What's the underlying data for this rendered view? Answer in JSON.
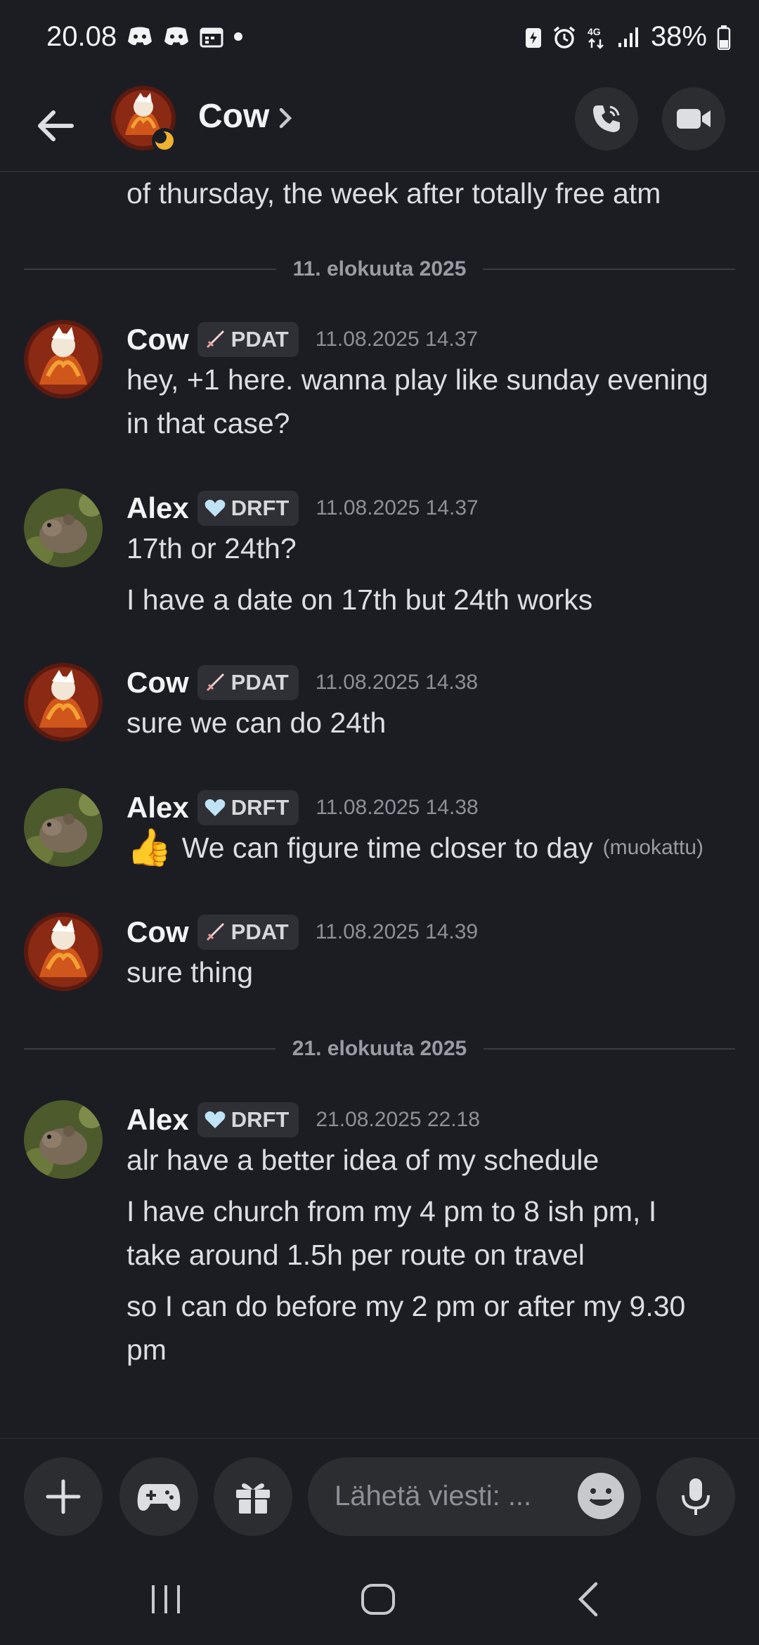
{
  "status_bar": {
    "time": "20.08",
    "battery": "38%",
    "network": "4G"
  },
  "header": {
    "title": "Cow",
    "back_icon": "arrow-left-icon",
    "call_icon": "phone-icon",
    "video_icon": "video-camera-icon"
  },
  "chat": {
    "top_partial": "of thursday, the week after totally free atm",
    "dividers": [
      "11. elokuuta 2025",
      "21. elokuuta 2025"
    ],
    "messages": [
      {
        "author": "Cow",
        "tag": "PDAT",
        "timestamp": "11.08.2025 14.37",
        "lines": [
          "hey, +1 here. wanna play like sunday evening",
          "in that case?"
        ]
      },
      {
        "author": "Alex",
        "tag": "DRFT",
        "timestamp": "11.08.2025 14.37",
        "lines": [
          "17th or 24th?",
          "I have a date on 17th but 24th works"
        ]
      },
      {
        "author": "Cow",
        "tag": "PDAT",
        "timestamp": "11.08.2025 14.38",
        "lines": [
          "sure we can do 24th"
        ]
      },
      {
        "author": "Alex",
        "tag": "DRFT",
        "timestamp": "11.08.2025 14.38",
        "lines": [
          "We can figure time closer to day"
        ],
        "emoji": "👍",
        "edited": "(muokattu)"
      },
      {
        "author": "Cow",
        "tag": "PDAT",
        "timestamp": "11.08.2025 14.39",
        "lines": [
          "sure thing"
        ]
      },
      {
        "author": "Alex",
        "tag": "DRFT",
        "timestamp": "21.08.2025 22.18",
        "lines": [
          "alr have a better idea of my schedule",
          "I have church from my 4 pm to 8 ish pm, I",
          "take around 1.5h per route on travel",
          "so I can do before my 2 pm or after my 9.30",
          "pm"
        ]
      }
    ]
  },
  "composer": {
    "placeholder": "Lähetä viesti: ...",
    "buttons": [
      "plus-icon",
      "gamepad-icon",
      "gift-icon",
      "emoji-icon",
      "microphone-icon"
    ]
  },
  "navbar": {
    "items": [
      "recent-apps-icon",
      "home-icon",
      "back-nav-icon"
    ]
  },
  "colors": {
    "background": "#1c1d22",
    "surface": "#2b2d31",
    "text": "#dcdee1",
    "muted": "#8e9097"
  }
}
